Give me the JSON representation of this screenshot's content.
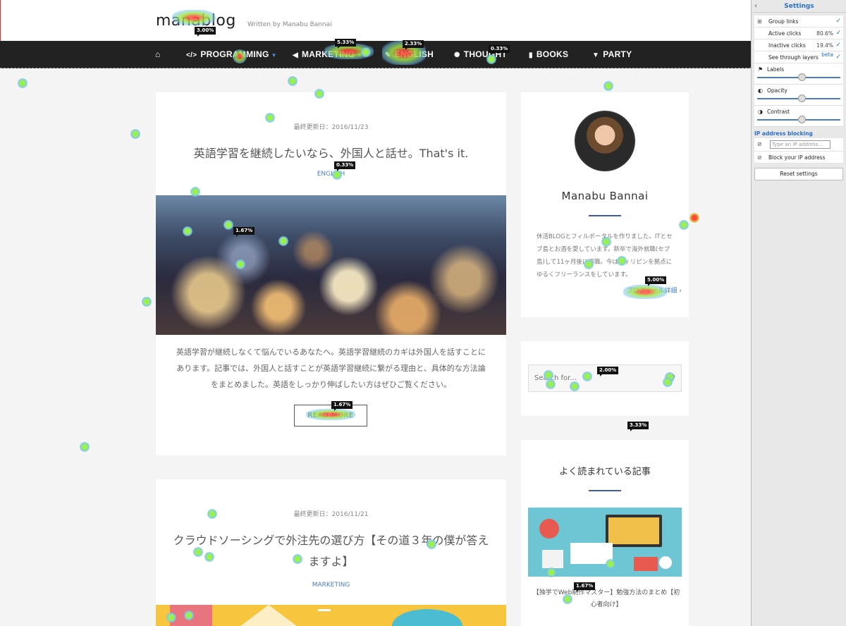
{
  "site": {
    "logo": "manablog",
    "tagline": "Written by Manabu Bannai"
  },
  "nav": {
    "home_icon": "home-icon",
    "items": [
      {
        "label": "PROGRAMMING",
        "icon": "code-icon",
        "dropdown": true
      },
      {
        "label": "MARKETING",
        "icon": "megaphone-icon",
        "dropdown": true
      },
      {
        "label": "ENGLISH",
        "icon": "pencil-icon",
        "dropdown": false
      },
      {
        "label": "THOUGHT",
        "icon": "spinner-icon",
        "dropdown": false
      },
      {
        "label": "BOOKS",
        "icon": "book-icon",
        "dropdown": false
      },
      {
        "label": "PARTY",
        "icon": "cocktail-icon",
        "dropdown": false
      }
    ]
  },
  "posts": [
    {
      "date": "最終更新日：2016/11/23",
      "title": "英語学習を継続したいなら、外国人と話せ。That's it.",
      "category": "ENGLISH",
      "excerpt": "英語学習が継続しなくて悩んでいるあなたへ。英語学習継続のカギは外国人を話すことにあります。記事では、外国人と話すことが英語学習継続に繋がる理由と、具体的な方法論をまとめました。英語をしっかり伸ばしたい方はぜひご覧ください。",
      "read_more": "READ MORE"
    },
    {
      "date": "最終更新日：2016/11/21",
      "title": "クラウドソーシングで外注先の選び方【その道３年の僕が答えますよ】",
      "category": "MARKETING"
    }
  ],
  "profile": {
    "name": "Manabu Bannai",
    "bio": "休活BLOGとフィルポータルを作りました。ITとセブ島とお酒を愛しています。新卒で海外就職(セブ島)して11ヶ月後に退職。今はフィリピンを拠点にゆるくフリーランスをしています。",
    "more": "プロフィール詳細 ›"
  },
  "search": {
    "placeholder": "Search for..."
  },
  "popular": {
    "title": "よく読まれている記事",
    "caption": "【独学でWeb制作マスター】勉強方法のまとめ【初心者向け】"
  },
  "settings": {
    "title": "Settings",
    "group_links": "Group links",
    "active_clicks": "Active clicks",
    "active_pct": "80.6%",
    "inactive_clicks": "Inactive clicks",
    "inactive_pct": "19.4%",
    "see_through": "See through layers",
    "beta": "beta",
    "labels": "Labels",
    "opacity": "Opacity",
    "contrast": "Contrast",
    "ip_section": "IP address blocking",
    "ip_placeholder": "Type an IP address...",
    "block_ip": "Block your IP address",
    "reset": "Reset settings",
    "sliders": {
      "labels": 0.62,
      "opacity": 0.62,
      "contrast": 0.62
    }
  },
  "heatmap": {
    "labels": [
      "3.00%",
      "5.33%",
      "2.33%",
      "0.33%",
      "0.33%",
      "1.67%",
      "5.00%",
      "1.67%",
      "2.00%",
      "3.33%",
      "1.67%"
    ]
  },
  "colors": {
    "nav_bg": "#222222",
    "accent": "#4a7cc0",
    "settings_accent": "#2a6fc9"
  }
}
